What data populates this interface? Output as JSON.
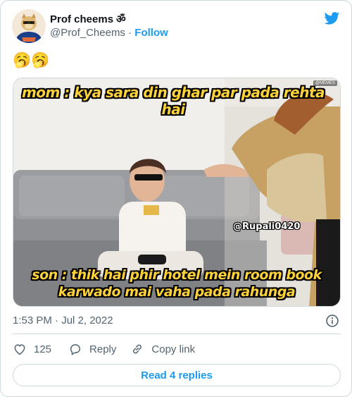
{
  "author": {
    "display_name": "Prof cheems",
    "badge": "ॐ",
    "handle": "@Prof_Cheems",
    "separator": "·",
    "follow_label": "Follow"
  },
  "tweet": {
    "text": "🥱🥱",
    "media": {
      "top_caption": "mom : kya sara din ghar par pada rehta hai",
      "bottom_caption": "son : thik hai phir hotel mein room book karwado mai vaha pada rahunga",
      "watermark": "@Rupali0420",
      "corner_tag": "@MEMES"
    }
  },
  "meta": {
    "timestamp": "1:53 PM · Jul 2, 2022"
  },
  "actions": {
    "like_count": "125",
    "reply_label": "Reply",
    "copy_label": "Copy link"
  },
  "replies_button": "Read 4 replies",
  "colors": {
    "brand_blue": "#1d9bf0",
    "secondary_text": "#536471",
    "border": "#cfd9de",
    "caption_yellow": "#ffd23a"
  }
}
